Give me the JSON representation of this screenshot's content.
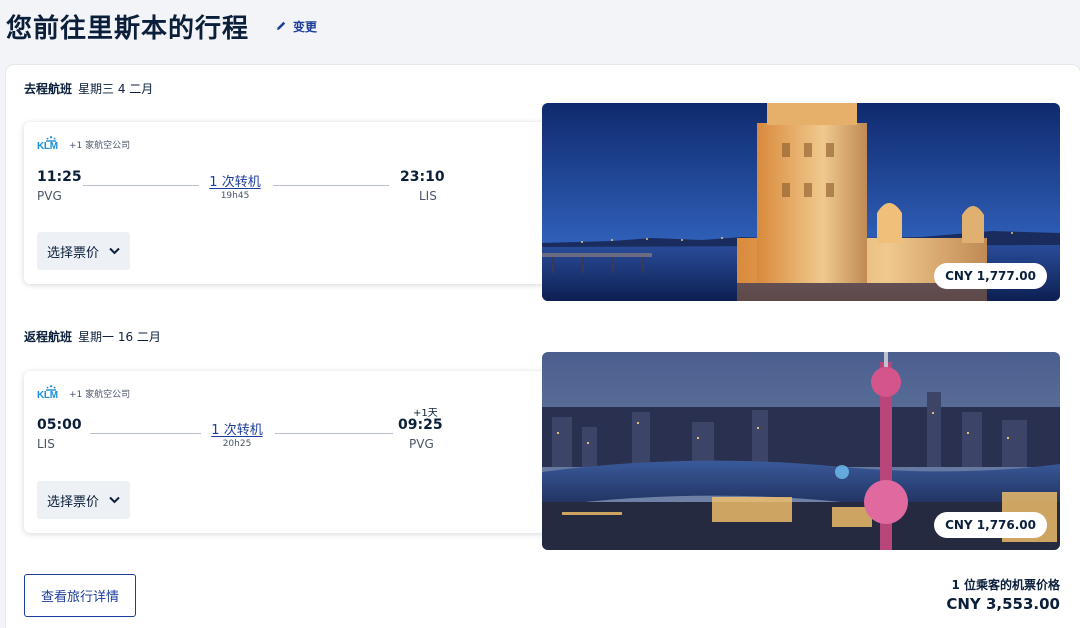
{
  "header": {
    "title": "您前往里斯本的行程",
    "edit_label": "变更"
  },
  "outbound": {
    "label": "去程航班",
    "date": "星期三 4 二月",
    "airline": "KLM",
    "carrier_extra": "+1 家航空公司",
    "depart_time": "11:25",
    "depart_airport": "PVG",
    "arrive_time": "23:10",
    "arrive_airport": "LIS",
    "stops": "1 次转机",
    "duration": "19h45",
    "fare_button": "选择票价",
    "price": "CNY 1,777.00"
  },
  "return": {
    "label": "返程航班",
    "date": "星期一 16 二月",
    "airline": "KLM",
    "carrier_extra": "+1 家航空公司",
    "depart_time": "05:00",
    "depart_airport": "LIS",
    "arrive_time": "09:25",
    "arrive_airport": "PVG",
    "next_day": "+1天",
    "stops": "1 次转机",
    "duration": "20h25",
    "fare_button": "选择票价",
    "price": "CNY 1,776.00"
  },
  "footer": {
    "details_button": "查看旅行详情",
    "total_label": "1 位乘客的机票价格",
    "total_price": "CNY 3,553.00"
  },
  "colors": {
    "brand_blue": "#1c3d9c",
    "navy_text": "#0b1f3b",
    "klm_blue": "#1a8fd6"
  }
}
